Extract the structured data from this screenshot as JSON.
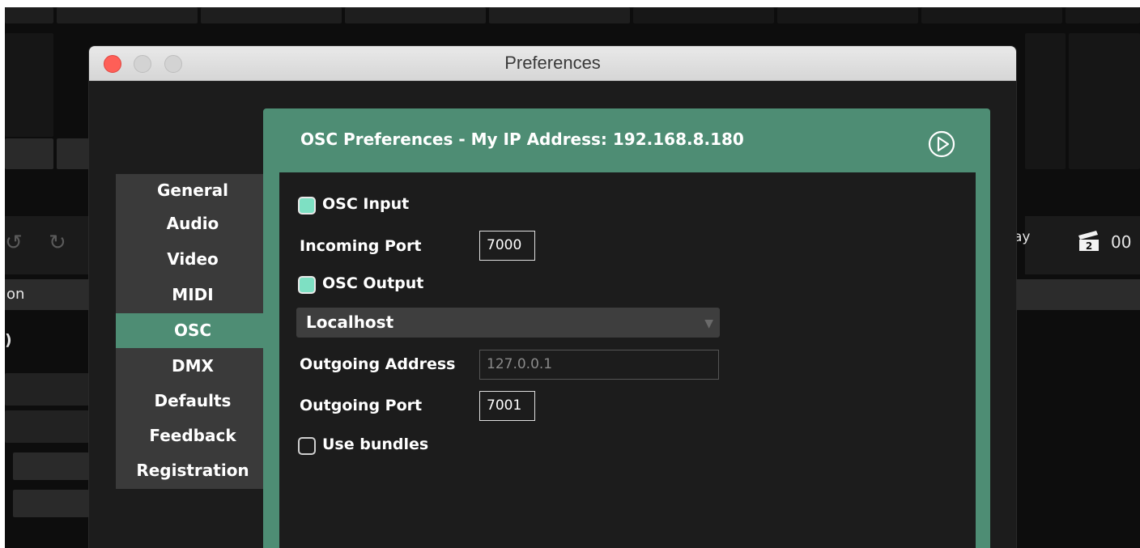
{
  "window": {
    "title": "Preferences"
  },
  "background_app": {
    "label_on": "on",
    "label_paren": ")",
    "label_ay": "ay",
    "counter_icon_text": "2",
    "counter_value": "00"
  },
  "nav": {
    "items": [
      {
        "label": "General",
        "active": false
      },
      {
        "label": "Audio",
        "active": false
      },
      {
        "label": "Video",
        "active": false
      },
      {
        "label": "MIDI",
        "active": false
      },
      {
        "label": "OSC",
        "active": true
      },
      {
        "label": "DMX",
        "active": false
      },
      {
        "label": "Defaults",
        "active": false
      },
      {
        "label": "Feedback",
        "active": false
      },
      {
        "label": "Registration",
        "active": false
      }
    ]
  },
  "panel": {
    "header": "OSC Preferences - My IP Address: 192.168.8.180",
    "run_icon": "play-circle-icon",
    "osc_input": {
      "label": "OSC Input",
      "checked": true
    },
    "incoming_port": {
      "label": "Incoming Port",
      "value": "7000"
    },
    "osc_output": {
      "label": "OSC Output",
      "checked": true
    },
    "destination": {
      "selected": "Localhost"
    },
    "outgoing_address": {
      "label": "Outgoing Address",
      "value": "127.0.0.1"
    },
    "outgoing_port": {
      "label": "Outgoing Port",
      "value": "7001"
    },
    "use_bundles": {
      "label": "Use bundles",
      "checked": false
    }
  },
  "colors": {
    "accent": "#4e8d74",
    "checkbox_on": "#7ee0c3",
    "close": "#fe5f57"
  }
}
